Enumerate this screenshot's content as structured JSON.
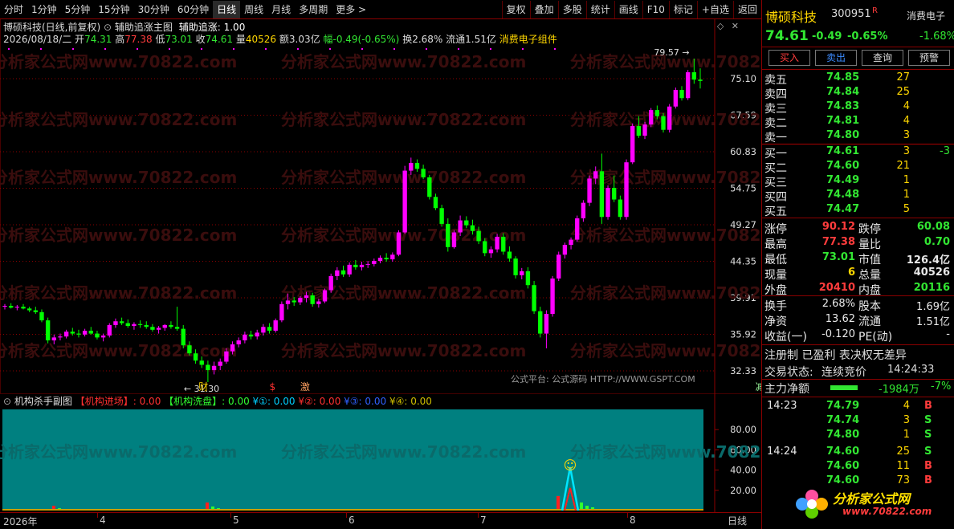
{
  "toolbar": {
    "periods": [
      "分时",
      "1分钟",
      "5分钟",
      "15分钟",
      "30分钟",
      "60分钟",
      "日线",
      "周线",
      "月线",
      "多周期",
      "更多 >"
    ],
    "active": "日线",
    "actions": [
      "复权",
      "叠加",
      "多股",
      "统计",
      "画线",
      "F10",
      "标记",
      "+自选",
      "返回"
    ]
  },
  "header": {
    "title": "博硕科技(日线,前复权)",
    "indicator": "辅助追涨主图",
    "indicator_value": "辅助追涨: 1.00",
    "date": "2026/08/18/二",
    "open_label": "开",
    "open": "74.31",
    "high_label": "高",
    "high": "77.38",
    "low_label": "低",
    "low": "73.01",
    "close_label": "收",
    "close": "74.61",
    "vol_label": "量",
    "vol": "40526",
    "amt_label": "额",
    "amt": "3.03亿",
    "chg_label": "幅",
    "chg": "-0.49(-0.65%)",
    "turn_label": "换",
    "turn": "2.68%",
    "float_label": "流通",
    "float": "1.51亿",
    "sector": "消费电子组件"
  },
  "main_chart": {
    "price_axis": [
      "75.10",
      "67.59",
      "60.83",
      "54.75",
      "49.27",
      "44.35",
      "39.91",
      "35.92",
      "32.33"
    ],
    "high_marker": "79.57",
    "low_marker": "31.30",
    "signals": [
      "财",
      "$",
      "激",
      "减"
    ],
    "source_text": "公式平台: 公式源码 HTTP://WWW.GSPT.COM",
    "watermark": "分析家公式网www.70822.com",
    "colors": {
      "up": "#ff00ff",
      "down": "#00ff00",
      "grid": "#8b0000"
    }
  },
  "sub_chart": {
    "title": "机构杀手副图",
    "items": [
      {
        "label": "【机构进场】",
        "value": ": 0.00",
        "color": "#ff3030"
      },
      {
        "label": "【机构洗盘】",
        "value": ": 0.00",
        "color": "#30ff30"
      },
      {
        "label": "¥①",
        "value": ": 0.00",
        "color": "#00cfff"
      },
      {
        "label": "¥②",
        "value": ": 0.00",
        "color": "#ff3030"
      },
      {
        "label": "¥③",
        "value": ": 0.00",
        "color": "#3060ff"
      },
      {
        "label": "¥④",
        "value": ": 0.00",
        "color": "#d0c000"
      }
    ],
    "axis": [
      "80.00",
      "60.00",
      "40.00",
      "20.00"
    ],
    "smiley": "☺"
  },
  "x_axis": {
    "labels": [
      "2026年",
      "4",
      "5",
      "6",
      "7",
      "8"
    ],
    "period": "日线"
  },
  "quote": {
    "name": "博硕科技",
    "code": "300951",
    "badge": "R",
    "sector": "消费电子",
    "price": "74.61",
    "change": "-0.49",
    "pct": "-0.65%",
    "sector_pct": "-1.68%",
    "buttons": [
      "买入",
      "卖出",
      "查询",
      "预警"
    ],
    "sells": [
      {
        "label": "卖五",
        "price": "74.85",
        "vol": "27"
      },
      {
        "label": "卖四",
        "price": "74.84",
        "vol": "25"
      },
      {
        "label": "卖三",
        "price": "74.83",
        "vol": "4"
      },
      {
        "label": "卖二",
        "price": "74.81",
        "vol": "4"
      },
      {
        "label": "卖一",
        "price": "74.80",
        "vol": "3"
      }
    ],
    "buys": [
      {
        "label": "买一",
        "price": "74.61",
        "vol": "3",
        "diff": "-3"
      },
      {
        "label": "买二",
        "price": "74.60",
        "vol": "21",
        "diff": ""
      },
      {
        "label": "买三",
        "price": "74.49",
        "vol": "1",
        "diff": ""
      },
      {
        "label": "买四",
        "price": "74.48",
        "vol": "1",
        "diff": ""
      },
      {
        "label": "买五",
        "price": "74.47",
        "vol": "5",
        "diff": ""
      }
    ],
    "stats": [
      {
        "l1": "涨停",
        "v1": "90.12",
        "c1": "red",
        "l2": "跌停",
        "v2": "60.08",
        "c2": "green"
      },
      {
        "l1": "最高",
        "v1": "77.38",
        "c1": "red",
        "l2": "量比",
        "v2": "0.70",
        "c2": "green"
      },
      {
        "l1": "最低",
        "v1": "73.01",
        "c1": "green",
        "l2": "市值",
        "v2": "126.4亿",
        "c2": "white"
      },
      {
        "l1": "现量",
        "v1": "6",
        "c1": "yellow",
        "l2": "总量",
        "v2": "40526",
        "c2": "white"
      },
      {
        "l1": "外盘",
        "v1": "20410",
        "c1": "red",
        "l2": "内盘",
        "v2": "20116",
        "c2": "green"
      }
    ],
    "stats2": [
      {
        "l1": "换手",
        "v1": "2.68%",
        "c1": "white",
        "l2": "股本",
        "v2": "1.69亿",
        "c2": "white"
      },
      {
        "l1": "净资",
        "v1": "13.62",
        "c1": "white",
        "l2": "流通",
        "v2": "1.51亿",
        "c2": "white"
      },
      {
        "l1": "收益(一)",
        "v1": "-0.120",
        "c1": "white",
        "l2": "PE(动)",
        "v2": "-",
        "c2": "white"
      }
    ],
    "tags": "注册制 已盈利 表决权无差异",
    "status_label": "交易状态:",
    "status": "连续竞价",
    "status_time": "14:24:33",
    "main_force_label": "主力净额",
    "main_force": "-1984万",
    "main_force_pct": "-7%",
    "ticks": [
      {
        "time": "14:23",
        "price": "74.79",
        "vol": "4",
        "side": "B"
      },
      {
        "time": "",
        "price": "74.74",
        "vol": "3",
        "side": "S"
      },
      {
        "time": "",
        "price": "74.80",
        "vol": "1",
        "side": "S"
      },
      {
        "time": "14:24",
        "price": "74.60",
        "vol": "25",
        "side": "S"
      },
      {
        "time": "",
        "price": "74.60",
        "vol": "11",
        "side": "B"
      },
      {
        "time": "",
        "price": "74.60",
        "vol": "73",
        "side": "B"
      }
    ],
    "logo_text": "分析家公式网",
    "logo_url": "www.70822.com"
  }
}
